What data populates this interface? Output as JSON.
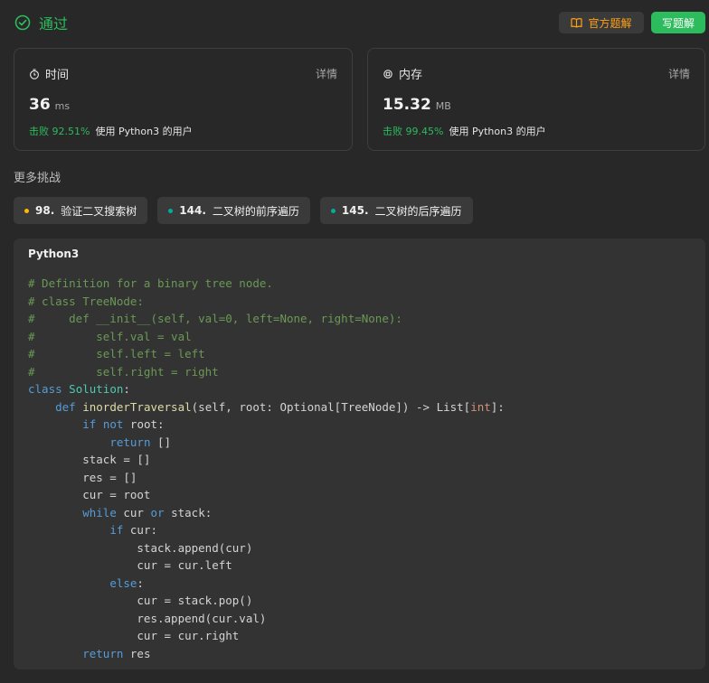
{
  "header": {
    "status": "通过",
    "official_solution_label": "官方题解",
    "write_solution_label": "写题解",
    "colors": {
      "accent_green": "#2cbb5d",
      "accent_orange": "#ffa116"
    }
  },
  "stats": {
    "time": {
      "title": "时间",
      "detail": "详情",
      "value": "36",
      "unit": "ms",
      "beat": "击败 92.51%",
      "desc": "使用 Python3 的用户"
    },
    "memory": {
      "title": "内存",
      "detail": "详情",
      "value": "15.32",
      "unit": "MB",
      "beat": "击败 99.45%",
      "desc": "使用 Python3 的用户"
    }
  },
  "more_challenges": {
    "title": "更多挑战",
    "items": [
      {
        "number": "98.",
        "title": "验证二叉搜索树",
        "difficulty_color": "#ffb800"
      },
      {
        "number": "144.",
        "title": "二叉树的前序遍历",
        "difficulty_color": "#00af9b"
      },
      {
        "number": "145.",
        "title": "二叉树的后序遍历",
        "difficulty_color": "#00af9b"
      }
    ]
  },
  "code": {
    "language": "Python3",
    "lines": [
      [
        {
          "t": "# Definition for a binary tree node.",
          "c": "comment"
        }
      ],
      [
        {
          "t": "# class TreeNode:",
          "c": "comment"
        }
      ],
      [
        {
          "t": "#     def __init__(self, val=0, left=None, right=None):",
          "c": "comment"
        }
      ],
      [
        {
          "t": "#         self.val = val",
          "c": "comment"
        }
      ],
      [
        {
          "t": "#         self.left = left",
          "c": "comment"
        }
      ],
      [
        {
          "t": "#         self.right = right",
          "c": "comment"
        }
      ],
      [
        {
          "t": "class",
          "c": "kw"
        },
        {
          "t": " ",
          "c": "plain"
        },
        {
          "t": "Solution",
          "c": "cls"
        },
        {
          "t": ":",
          "c": "plain"
        }
      ],
      [
        {
          "t": "    ",
          "c": "plain"
        },
        {
          "t": "def",
          "c": "kw"
        },
        {
          "t": " ",
          "c": "plain"
        },
        {
          "t": "inorderTraversal",
          "c": "fn"
        },
        {
          "t": "(self, root: Optional[TreeNode]) -> List[",
          "c": "plain"
        },
        {
          "t": "int",
          "c": "type"
        },
        {
          "t": "]:",
          "c": "plain"
        }
      ],
      [
        {
          "t": "        ",
          "c": "plain"
        },
        {
          "t": "if",
          "c": "kw"
        },
        {
          "t": " ",
          "c": "plain"
        },
        {
          "t": "not",
          "c": "kw"
        },
        {
          "t": " root:",
          "c": "plain"
        }
      ],
      [
        {
          "t": "            ",
          "c": "plain"
        },
        {
          "t": "return",
          "c": "kw"
        },
        {
          "t": " []",
          "c": "plain"
        }
      ],
      [
        {
          "t": "        stack = []",
          "c": "plain"
        }
      ],
      [
        {
          "t": "        res = []",
          "c": "plain"
        }
      ],
      [
        {
          "t": "        cur = root",
          "c": "plain"
        }
      ],
      [
        {
          "t": "        ",
          "c": "plain"
        },
        {
          "t": "while",
          "c": "kw"
        },
        {
          "t": " cur ",
          "c": "plain"
        },
        {
          "t": "or",
          "c": "kw"
        },
        {
          "t": " stack:",
          "c": "plain"
        }
      ],
      [
        {
          "t": "            ",
          "c": "plain"
        },
        {
          "t": "if",
          "c": "kw"
        },
        {
          "t": " cur:",
          "c": "plain"
        }
      ],
      [
        {
          "t": "                stack.append(cur)",
          "c": "plain"
        }
      ],
      [
        {
          "t": "                cur = cur.left",
          "c": "plain"
        }
      ],
      [
        {
          "t": "            ",
          "c": "plain"
        },
        {
          "t": "else",
          "c": "kw"
        },
        {
          "t": ":",
          "c": "plain"
        }
      ],
      [
        {
          "t": "                cur = stack.pop()",
          "c": "plain"
        }
      ],
      [
        {
          "t": "                res.append(cur.val)",
          "c": "plain"
        }
      ],
      [
        {
          "t": "                cur = cur.right",
          "c": "plain"
        }
      ],
      [
        {
          "t": "        ",
          "c": "plain"
        },
        {
          "t": "return",
          "c": "kw"
        },
        {
          "t": " res",
          "c": "plain"
        }
      ]
    ]
  }
}
